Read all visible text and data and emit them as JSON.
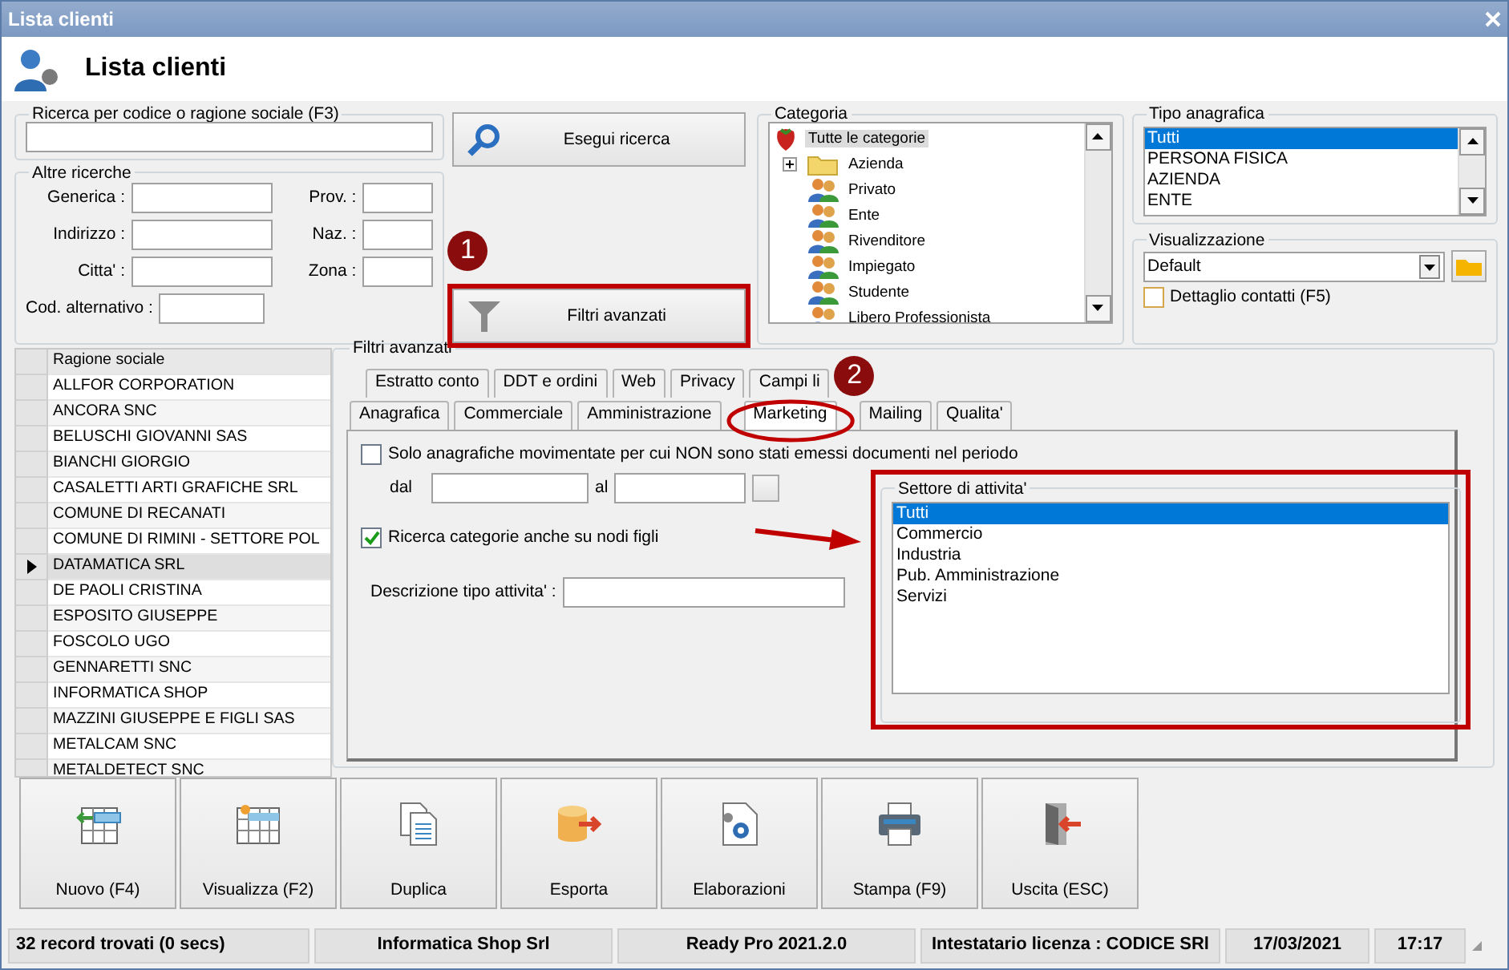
{
  "window": {
    "title": "Lista clienti"
  },
  "header": {
    "title": "Lista clienti"
  },
  "search": {
    "label": "Ricerca per codice o ragione sociale (F3)"
  },
  "search_button": {
    "label": "Esegui ricerca"
  },
  "filter_button": {
    "label": "Filtri avanzati"
  },
  "other_searches": {
    "label": "Altre ricerche",
    "fields": [
      {
        "label": "Generica :"
      },
      {
        "label": "Prov. :"
      },
      {
        "label": "Indirizzo :"
      },
      {
        "label": "Naz. :"
      },
      {
        "label": "Citta' :"
      },
      {
        "label": "Zona :"
      },
      {
        "label": "Cod. alternativo :"
      }
    ]
  },
  "category": {
    "label": "Categoria",
    "items": [
      {
        "label": "Tutte le categorie",
        "kind": "root",
        "selected": true,
        "children": [
          {
            "label": "Azienda",
            "kind": "folder",
            "selected": false,
            "expanded": false
          },
          {
            "label": "Privato",
            "kind": "group",
            "selected": false
          },
          {
            "label": "Ente",
            "kind": "group",
            "selected": false
          },
          {
            "label": "Rivenditore",
            "kind": "group",
            "selected": false
          },
          {
            "label": "Impiegato",
            "kind": "group",
            "selected": false
          },
          {
            "label": "Studente",
            "kind": "group",
            "selected": false
          },
          {
            "label": "Libero Professionista",
            "kind": "group",
            "selected": false
          }
        ]
      }
    ]
  },
  "registry_type": {
    "label": "Tipo anagrafica",
    "items": [
      {
        "label": "Tutti",
        "selected": true
      },
      {
        "label": "PERSONA FISICA",
        "selected": false
      },
      {
        "label": "AZIENDA",
        "selected": false
      },
      {
        "label": "ENTE",
        "selected": false
      }
    ]
  },
  "view": {
    "label": "Visualizzazione",
    "value": "Default",
    "checkbox": {
      "label": "Dettaglio contatti (F5)",
      "checked": false
    }
  },
  "grid": {
    "columns": [
      "Ragione sociale"
    ],
    "rows": [
      {
        "name": "ALLFOR CORPORATION",
        "selected": false
      },
      {
        "name": "ANCORA SNC",
        "selected": false
      },
      {
        "name": "BELUSCHI GIOVANNI SAS",
        "selected": false
      },
      {
        "name": "BIANCHI GIORGIO",
        "selected": false
      },
      {
        "name": "CASALETTI ARTI GRAFICHE SRL",
        "selected": false
      },
      {
        "name": "COMUNE DI RECANATI",
        "selected": false
      },
      {
        "name": "COMUNE DI RIMINI - SETTORE POL",
        "selected": false
      },
      {
        "name": "DATAMATICA SRL",
        "selected": true
      },
      {
        "name": "DE PAOLI CRISTINA",
        "selected": false
      },
      {
        "name": "ESPOSITO GIUSEPPE",
        "selected": false
      },
      {
        "name": "FOSCOLO UGO",
        "selected": false
      },
      {
        "name": "GENNARETTI SNC",
        "selected": false
      },
      {
        "name": "INFORMATICA SHOP",
        "selected": false
      },
      {
        "name": "MAZZINI GIUSEPPE E FIGLI SAS",
        "selected": false
      },
      {
        "name": "METALCAM SNC",
        "selected": false
      },
      {
        "name": "METALDETECT SNC",
        "selected": false
      }
    ]
  },
  "advanced_filters": {
    "label": "Filtri avanzati",
    "tabs_back": [
      {
        "label": "Estratto conto",
        "selected": false
      },
      {
        "label": "DDT e ordini",
        "selected": false
      },
      {
        "label": "Web",
        "selected": false
      },
      {
        "label": "Privacy",
        "selected": false
      },
      {
        "label": "Campi li",
        "selected": false
      }
    ],
    "tabs_front": [
      {
        "label": "Anagrafica",
        "selected": false
      },
      {
        "label": "Commerciale",
        "selected": false
      },
      {
        "label": "Amministrazione",
        "selected": false
      },
      {
        "label": "Marketing",
        "selected": true
      },
      {
        "label": "Mailing",
        "selected": false
      },
      {
        "label": "Qualita'",
        "selected": false
      }
    ],
    "period_checkbox": {
      "label": "Solo anagrafiche movimentate per cui NON sono stati emessi documenti nel periodo",
      "checked": false
    },
    "from_label": "dal",
    "to_label": "al",
    "children_checkbox": {
      "label": "Ricerca categorie anche su nodi figli",
      "checked": true
    },
    "activity_description": {
      "label": "Descrizione tipo attivita' :"
    },
    "sector": {
      "label": "Settore di attivita'",
      "items": [
        {
          "label": "Tutti",
          "selected": true
        },
        {
          "label": "Commercio",
          "selected": false
        },
        {
          "label": "Industria",
          "selected": false
        },
        {
          "label": "Pub. Amministrazione",
          "selected": false
        },
        {
          "label": "Servizi",
          "selected": false
        }
      ]
    }
  },
  "callouts": [
    {
      "label": "1"
    },
    {
      "label": "2"
    }
  ],
  "toolbar": [
    {
      "label": "Nuovo (F4)",
      "kind": "new"
    },
    {
      "label": "Visualizza (F2)",
      "kind": "view"
    },
    {
      "label": "Duplica",
      "kind": "copy"
    },
    {
      "label": "Esporta",
      "kind": "export"
    },
    {
      "label": "Elaborazioni",
      "kind": "process"
    },
    {
      "label": "Stampa (F9)",
      "kind": "print"
    },
    {
      "label": "Uscita (ESC)",
      "kind": "exit"
    }
  ],
  "status_bar": [
    "32 record trovati (0 secs)",
    "Informatica Shop Srl",
    "Ready Pro 2021.2.0",
    "Intestatario licenza : CODICE SRl",
    "17/03/2021",
    "17:17"
  ]
}
